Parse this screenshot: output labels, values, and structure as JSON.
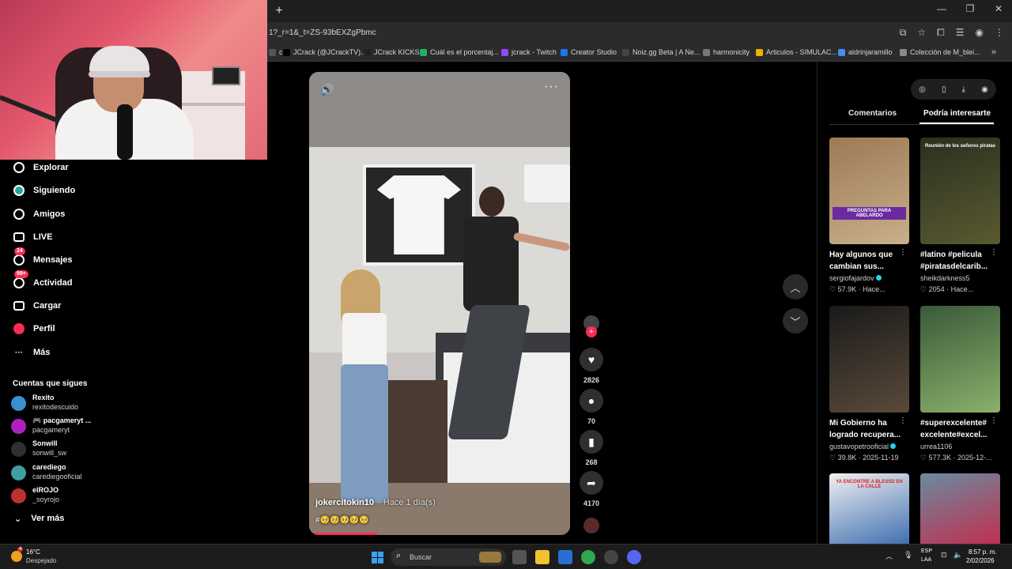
{
  "browser": {
    "new_tab": "+",
    "url": "1?_r=1&_t=ZS-93bEXZgPbmc",
    "bookmarks": [
      {
        "label": "ch",
        "color": "#555555"
      },
      {
        "label": "JCrack (@JCrackTV)...",
        "color": "#000000"
      },
      {
        "label": "JCrack KICKS",
        "color": "#222222"
      },
      {
        "label": "Cuál es el porcentaj...",
        "color": "#20b060"
      },
      {
        "label": "jcrack - Twitch",
        "color": "#9146ff"
      },
      {
        "label": "Creator Studio",
        "color": "#1877f2"
      },
      {
        "label": "Noiz.gg Beta | A Ne...",
        "color": "#444444"
      },
      {
        "label": "harmonicity",
        "color": "#777777"
      },
      {
        "label": "Articulos - SIMULAC...",
        "color": "#f0b000"
      },
      {
        "label": "aldrinjaramillo",
        "color": "#4a8af0"
      },
      {
        "label": "Colección de M_blei...",
        "color": "#888888"
      }
    ],
    "more": "»"
  },
  "nav": {
    "items": [
      {
        "label": "Explorar",
        "icon": "compass-icon"
      },
      {
        "label": "Siguiendo",
        "icon": "following-icon"
      },
      {
        "label": "Amigos",
        "icon": "friends-icon"
      },
      {
        "label": "LIVE",
        "icon": "live-icon"
      },
      {
        "label": "Mensajes",
        "icon": "messages-icon",
        "badge": "24"
      },
      {
        "label": "Actividad",
        "icon": "activity-icon",
        "badge": "99+"
      },
      {
        "label": "Cargar",
        "icon": "upload-icon"
      },
      {
        "label": "Perfil",
        "icon": "profile-icon"
      },
      {
        "label": "Más",
        "icon": "more-icon"
      }
    ],
    "following_title": "Cuentas que sigues",
    "following": [
      {
        "name": "Rexito",
        "handle": "rexitodescuido",
        "color": "#3a8fd0"
      },
      {
        "name": "🎮 pacgameryt ...",
        "handle": "pacgameryt",
        "color": "#b020c0"
      },
      {
        "name": "Sonwill",
        "handle": "sonwill_sw",
        "color": "#303030"
      },
      {
        "name": "carediego",
        "handle": "carediegooficial",
        "color": "#40a0a0"
      },
      {
        "name": "elROJO",
        "handle": "_soyrojo",
        "color": "#c03030"
      }
    ],
    "see_more": "Ver más"
  },
  "video": {
    "author": "jokercitokin10",
    "time": "· Hace 1 día(s)",
    "tags": "#🥺🥺🥺🥺🥺",
    "progress": 0.26
  },
  "actions": {
    "likes": "2826",
    "comments": "70",
    "saves": "268",
    "shares": "4170"
  },
  "panel": {
    "tabs": [
      "Comentarios",
      "Podría interesarte"
    ],
    "active_tab": 1,
    "cards": [
      {
        "title": "Hay algunos que cambian sus...",
        "user": "sergiofajardov",
        "verified": true,
        "likes": "57.9K",
        "date": "Hace...",
        "colors": [
          "#9c7a55",
          "#c8b08a"
        ],
        "overlay": "PREGUNTAS PARA ABELARDO"
      },
      {
        "title": "#latino #pelicula #piratasdelcarib...",
        "user": "sheikdarkness5",
        "verified": false,
        "likes": "2054",
        "date": "Hace...",
        "colors": [
          "#2a3020",
          "#5a5a30"
        ],
        "overlay": "Reunión de los señores piratas"
      },
      {
        "title": "Mi Gobierno ha logrado recupera...",
        "user": "gustavopetrooficial",
        "verified": true,
        "likes": "39.8K",
        "date": "2025-11-19",
        "colors": [
          "#1a1a1a",
          "#5a4a3a"
        ],
        "overlay": ""
      },
      {
        "title": "#superexcelente# excelente#excel...",
        "user": "urrea1106",
        "verified": false,
        "likes": "577.3K",
        "date": "2025-12-...",
        "colors": [
          "#3a5a3a",
          "#8ab06a"
        ],
        "overlay": ""
      },
      {
        "title": "",
        "user": "",
        "verified": false,
        "likes": "",
        "date": "",
        "colors": [
          "#f0f0f0",
          "#4070b0"
        ],
        "overlay": "YA ENCONTRE A BLESSD EN LA CALLE"
      },
      {
        "title": "",
        "user": "",
        "verified": false,
        "likes": "",
        "date": "",
        "colors": [
          "#6a8aa0",
          "#c03050"
        ],
        "overlay": ""
      }
    ]
  },
  "taskbar": {
    "weather_temp": "16°C",
    "weather_desc": "Despejado",
    "weather_badge": "4",
    "search_placeholder": "Buscar",
    "lang_top": "ESP",
    "lang_bottom": "LAA",
    "time": "8:57 p. m.",
    "date": "2/02/2026"
  }
}
